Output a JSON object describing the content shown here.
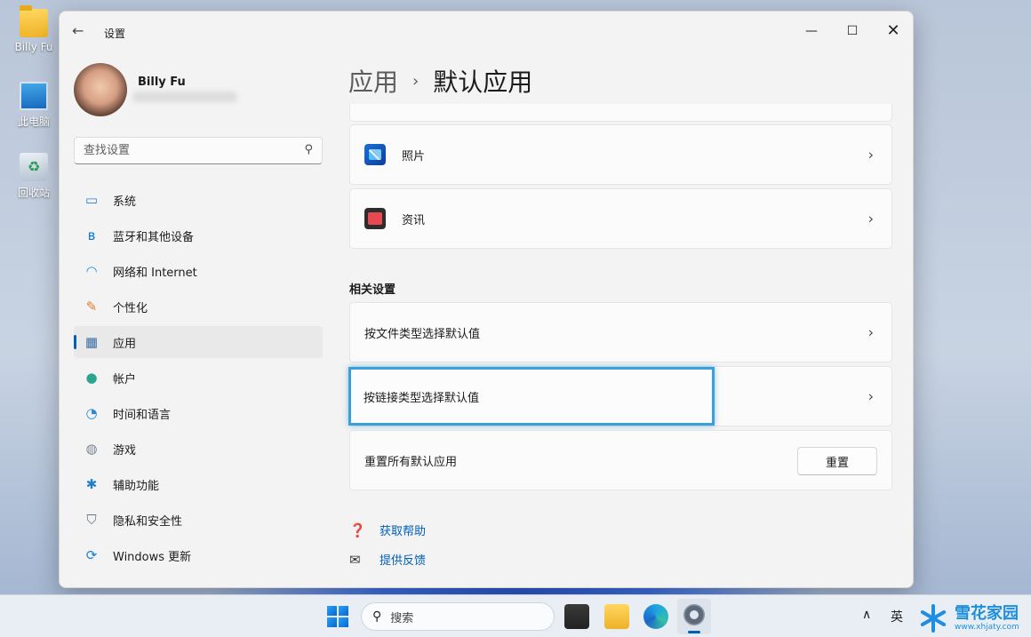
{
  "desktop": {
    "icons": [
      {
        "label": "Billy Fu",
        "icon": "folder-icon"
      },
      {
        "label": "此电脑",
        "icon": "computer-icon"
      },
      {
        "label": "回收站",
        "icon": "recycle-bin-icon"
      }
    ]
  },
  "window": {
    "title": "设置",
    "back_glyph": "←",
    "minimize_glyph": "—",
    "maximize_glyph": "☐",
    "close_glyph": "✕"
  },
  "user": {
    "name": "Billy Fu"
  },
  "search": {
    "placeholder": "查找设置",
    "icon_glyph": "⚲"
  },
  "nav": {
    "items": [
      {
        "label": "系统",
        "icon": "monitor-icon",
        "glyph": "▭",
        "color": "#2b7cd3"
      },
      {
        "label": "蓝牙和其他设备",
        "icon": "bluetooth-icon",
        "glyph": "ʙ",
        "color": "#0a78d7"
      },
      {
        "label": "网络和 Internet",
        "icon": "wifi-icon",
        "glyph": "◠",
        "color": "#1e90e6"
      },
      {
        "label": "个性化",
        "icon": "paintbrush-icon",
        "glyph": "✎",
        "color": "#e07b2a"
      },
      {
        "label": "应用",
        "icon": "apps-icon",
        "glyph": "▦",
        "color": "#3a6ea5"
      },
      {
        "label": "帐户",
        "icon": "account-icon",
        "glyph": "●",
        "color": "#2ca58d"
      },
      {
        "label": "时间和语言",
        "icon": "clock-globe-icon",
        "glyph": "◔",
        "color": "#2a86d6"
      },
      {
        "label": "游戏",
        "icon": "gamepad-icon",
        "glyph": "◍",
        "color": "#7a8592"
      },
      {
        "label": "辅助功能",
        "icon": "accessibility-icon",
        "glyph": "✱",
        "color": "#1e7fd0"
      },
      {
        "label": "隐私和安全性",
        "icon": "shield-icon",
        "glyph": "⛉",
        "color": "#6b7480"
      },
      {
        "label": "Windows 更新",
        "icon": "update-icon",
        "glyph": "⟳",
        "color": "#1a7fd4"
      }
    ],
    "active_index": 4
  },
  "breadcrumb": {
    "parent": "应用",
    "separator": "›",
    "current": "默认应用"
  },
  "apps_list": {
    "items": [
      {
        "label": "照片",
        "icon": "photos-icon"
      },
      {
        "label": "资讯",
        "icon": "news-icon"
      }
    ],
    "chevron": "›"
  },
  "related": {
    "heading": "相关设置",
    "items": [
      {
        "label": "按文件类型选择默认值"
      },
      {
        "label": "按链接类型选择默认值"
      }
    ],
    "reset_label": "重置所有默认应用",
    "reset_button": "重置"
  },
  "links": {
    "help": "获取帮助",
    "feedback": "提供反馈"
  },
  "taskbar": {
    "search_label": "搜索",
    "tray_chevron": "∧",
    "ime": "英"
  },
  "watermark": {
    "title": "雪花家园",
    "url": "www.xhjaty.com"
  },
  "colors": {
    "accent": "#005fb8",
    "highlight": "#3aa0d8"
  }
}
